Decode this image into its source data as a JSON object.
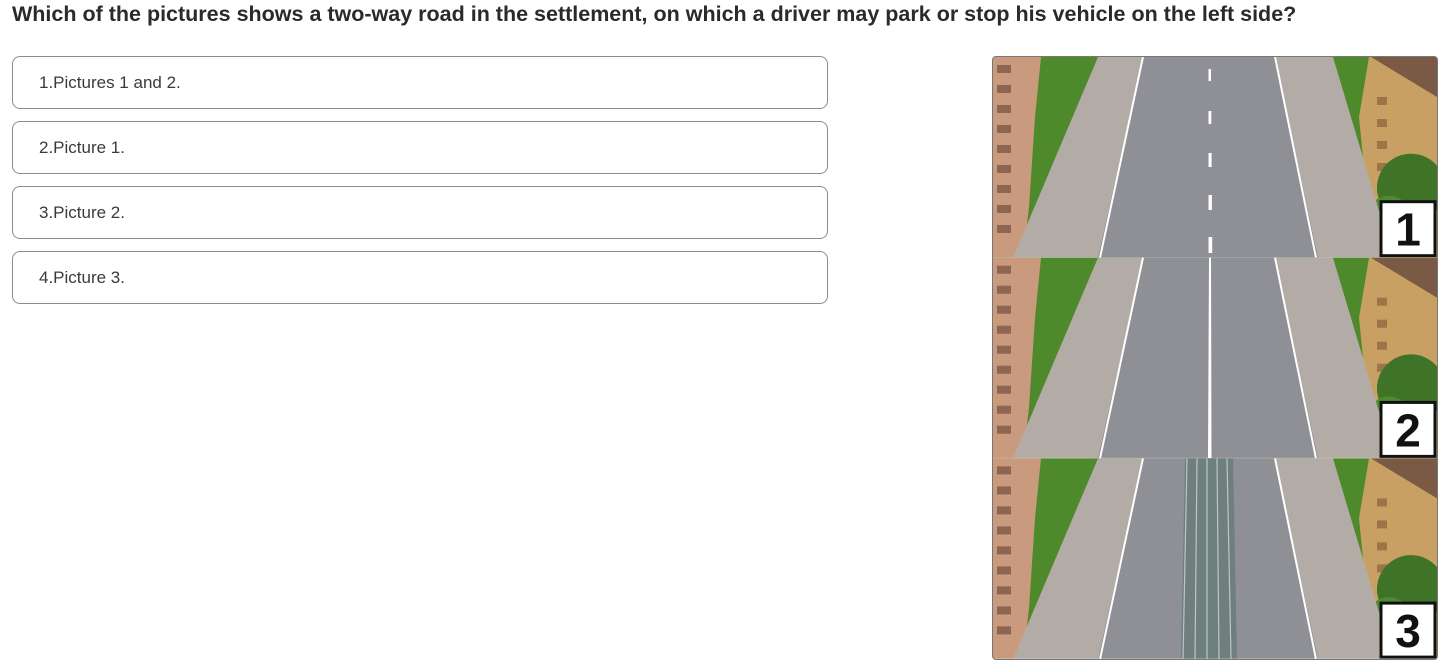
{
  "question": {
    "text": "Which of the pictures shows a two-way road in the settlement, on which a driver may park or stop his vehicle on the left side?"
  },
  "answers": [
    {
      "label": "1.Pictures 1 and 2."
    },
    {
      "label": "2.Picture 1."
    },
    {
      "label": "3.Picture 2."
    },
    {
      "label": "4.Picture 3."
    }
  ],
  "illustration": {
    "panels": [
      {
        "number": "1",
        "marking": "broken-center-line"
      },
      {
        "number": "2",
        "marking": "solid-center-line"
      },
      {
        "number": "3",
        "marking": "median-strip"
      }
    ],
    "colors": {
      "road": "#8f8f96",
      "sidewalk": "#b3aca6",
      "grass": "#4e8a2b",
      "building_left": "#c99a7e",
      "building_right": "#c8a063",
      "marking": "#ffffff",
      "median": "#6f7f7e"
    }
  }
}
